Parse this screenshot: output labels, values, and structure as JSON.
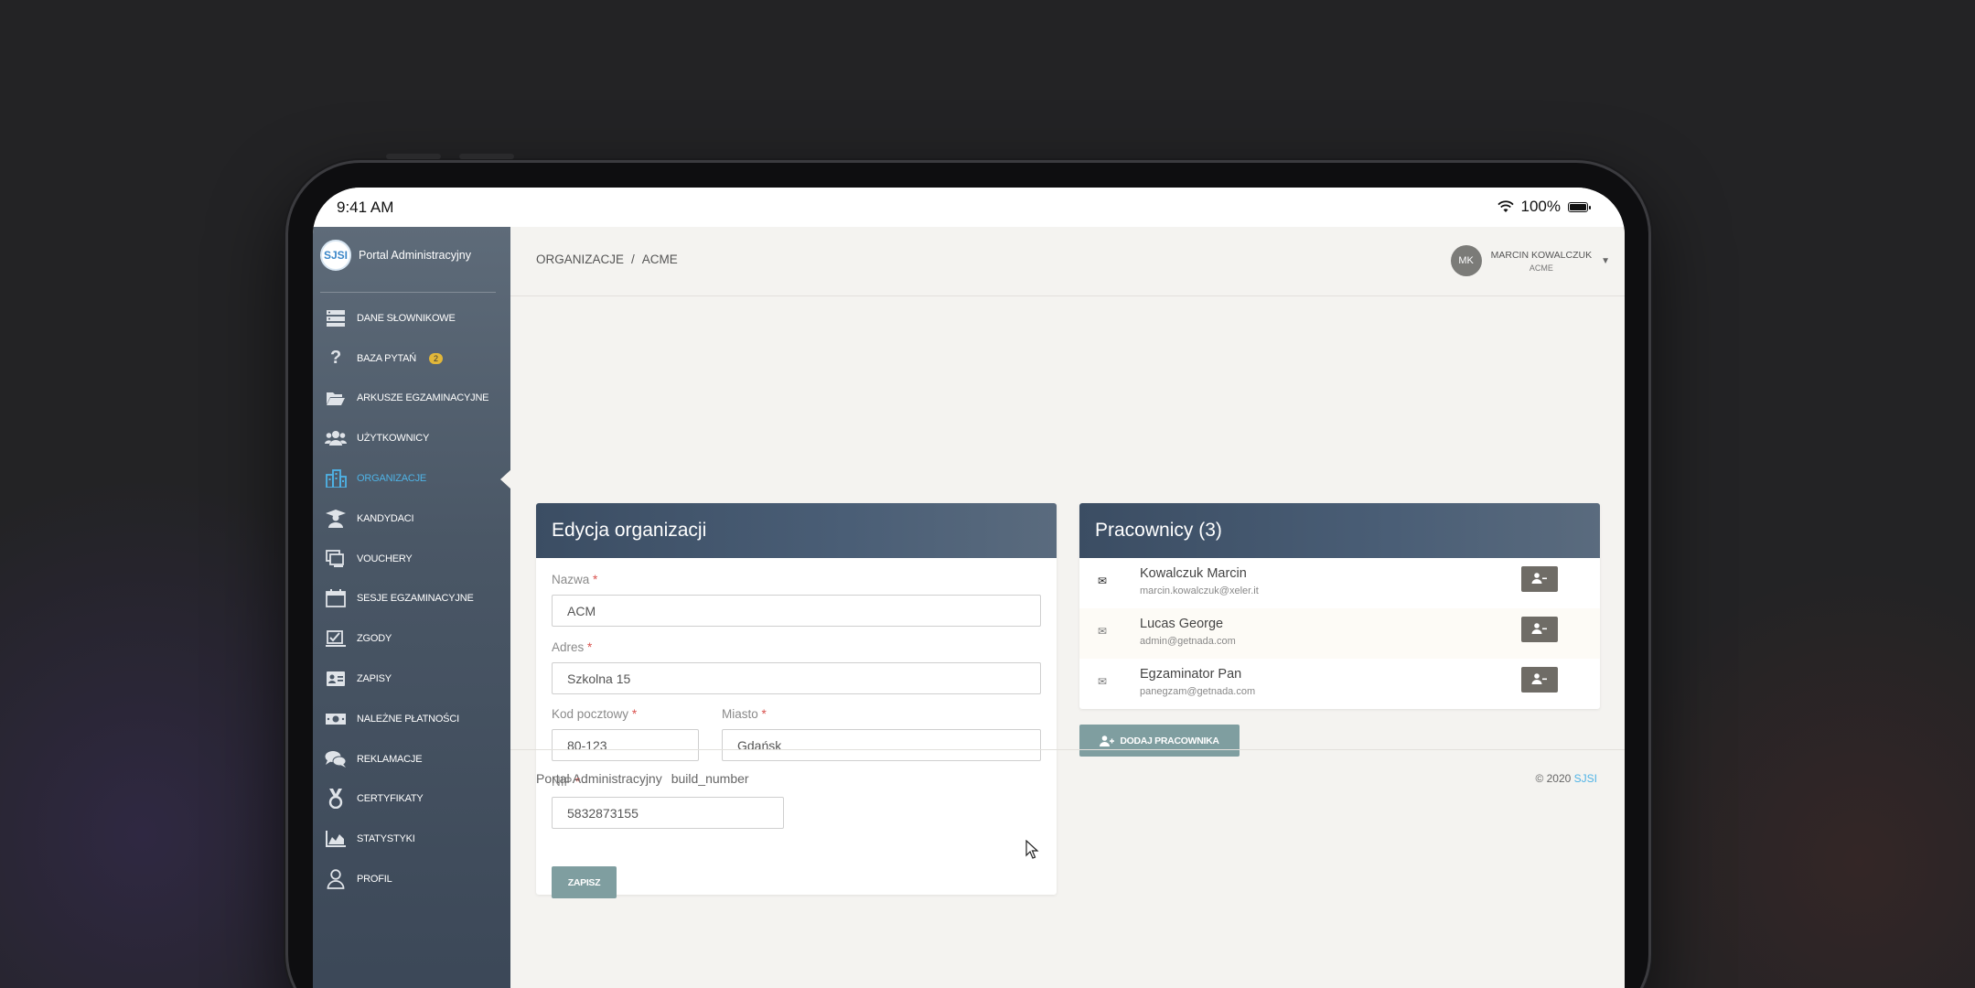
{
  "status_bar": {
    "time": "9:41 AM",
    "battery": "100%"
  },
  "sidebar": {
    "logo": "SJSI",
    "app_name": "Portal Administracyjny",
    "items": [
      {
        "label": "Dane słownikowe",
        "icon": "database-icon"
      },
      {
        "label": "Baza pytań",
        "icon": "question-icon",
        "badge": "2"
      },
      {
        "label": "Arkusze egzaminacyjne",
        "icon": "folder-open-icon"
      },
      {
        "label": "Użytkownicy",
        "icon": "users-icon"
      },
      {
        "label": "Organizacje",
        "icon": "building-icon",
        "active": true
      },
      {
        "label": "Kandydaci",
        "icon": "graduate-icon"
      },
      {
        "label": "Vouchery",
        "icon": "vouchers-icon"
      },
      {
        "label": "Sesje egzaminacyjne",
        "icon": "calendar-icon"
      },
      {
        "label": "Zgody",
        "icon": "check-icon"
      },
      {
        "label": "Zapisy",
        "icon": "id-card-icon"
      },
      {
        "label": "Należne płatności",
        "icon": "money-icon"
      },
      {
        "label": "Reklamacje",
        "icon": "comments-icon"
      },
      {
        "label": "Certyfikaty",
        "icon": "medal-icon"
      },
      {
        "label": "Statystyki",
        "icon": "chart-icon"
      },
      {
        "label": "Profil",
        "icon": "user-icon"
      }
    ]
  },
  "header": {
    "breadcrumb": [
      "ORGANIZACJE",
      "/",
      "ACME"
    ],
    "user": {
      "initials": "MK",
      "name": "MARCIN KOWALCZUK",
      "org": "ACME"
    }
  },
  "form": {
    "title": "Edycja organizacji",
    "name_label": "Nazwa",
    "name_value": "ACM",
    "address_label": "Adres",
    "address_value": "Szkolna 15",
    "postal_label": "Kod pocztowy",
    "postal_value": "80-123",
    "city_label": "Miasto",
    "city_value": "Gdańsk",
    "nip_label": "NIP",
    "nip_value": "5832873155",
    "required_mark": "*",
    "save_label": "ZAPISZ"
  },
  "employees": {
    "title": "Pracownicy (3)",
    "rows": [
      {
        "name": "Kowalczuk Marcin",
        "email": "marcin.kowalczuk@xeler.it"
      },
      {
        "name": "Lucas George",
        "email": "admin@getnada.com"
      },
      {
        "name": "Egzaminator Pan",
        "email": "panegzam@getnada.com"
      }
    ],
    "add_label": "DODAJ PRACOWNIKA"
  },
  "footer": {
    "app": "Portal Administracyjny",
    "build": "build_number",
    "copyright": "© 2020",
    "brand": "SJSI"
  },
  "colors": {
    "accent": "#4fb3e6",
    "header_bar": "#3b4d63",
    "button": "#7f9ea0",
    "required": "#d9534f"
  }
}
